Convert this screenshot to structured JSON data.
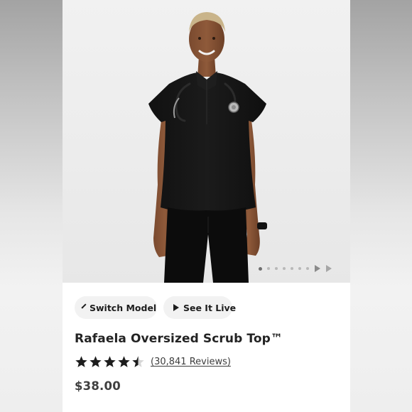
{
  "product": {
    "name": "Rafaela Oversized Scrub Top™",
    "price": "$38.00",
    "rating": {
      "value": 4.5,
      "max": 5,
      "reviews_label": "(30,841 Reviews)"
    }
  },
  "actions": {
    "switch_model_label": "Switch Model",
    "see_it_live_label": "See It Live"
  },
  "carousel": {
    "slide_count": 7,
    "current_slide": 1
  },
  "icons": {
    "switch_model": "chevron-down-icon",
    "see_it_live": "play-icon",
    "carousel_next": "chevron-right-icon",
    "rating": "star-icon"
  },
  "colors": {
    "accent": "#1d1d1d",
    "button_bg": "#f2f2f2",
    "page_bg": "#ffffff",
    "backdrop": "#c0c0c0"
  }
}
